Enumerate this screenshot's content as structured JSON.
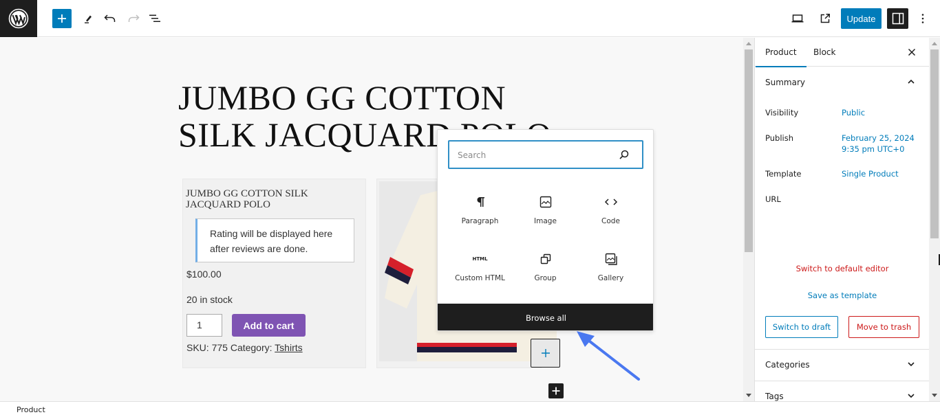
{
  "toolbar": {
    "logo": "wordpress-logo",
    "inserter_icon": "plus-icon",
    "tools_icon": "pencil-icon",
    "undo_icon": "undo-icon",
    "redo_icon": "redo-icon",
    "list_view_icon": "list-view-icon",
    "preview_icon": "desktop-icon",
    "view_post_icon": "external-link-icon",
    "update_label": "Update",
    "settings_icon": "sidebar-icon",
    "options_icon": "more-vertical-icon"
  },
  "canvas": {
    "post_title": "JUMBO GG COTTON SILK JACQUARD POLO",
    "product": {
      "name": "JUMBO GG COTTON SILK JACQUARD POLO",
      "rating_notice": "Rating will be displayed here after reviews are done.",
      "price": "$100.00",
      "stock": "20 in stock",
      "quantity": "1",
      "add_to_cart_label": "Add to cart",
      "sku_label": "SKU:",
      "sku_value": "775",
      "category_label": "Category:",
      "category_value": "Tshirts"
    },
    "image_alt": "Cream knit polo shirt with red and navy stripes"
  },
  "inserter": {
    "search_placeholder": "Search",
    "search_value": "",
    "blocks": [
      {
        "label": "Paragraph",
        "icon": "paragraph-icon"
      },
      {
        "label": "Image",
        "icon": "image-icon"
      },
      {
        "label": "Code",
        "icon": "code-icon"
      },
      {
        "label": "Custom HTML",
        "icon": "html-icon"
      },
      {
        "label": "Group",
        "icon": "group-icon"
      },
      {
        "label": "Gallery",
        "icon": "gallery-icon"
      }
    ],
    "html_icon_text": "HTML",
    "browse_all_label": "Browse all"
  },
  "sidebar": {
    "tabs": [
      {
        "label": "Product",
        "active": true
      },
      {
        "label": "Block",
        "active": false
      }
    ],
    "summary": {
      "title": "Summary",
      "rows": [
        {
          "label": "Visibility",
          "value": "Public"
        },
        {
          "label": "Publish",
          "value_line1": "February 25, 2024",
          "value_line2": "9:35 pm UTC+0"
        },
        {
          "label": "Template",
          "value": "Single Product"
        },
        {
          "label": "URL",
          "value": ""
        }
      ],
      "switch_editor_label": "Switch to default editor",
      "save_template_label": "Save as template",
      "switch_draft_label": "Switch to draft",
      "move_trash_label": "Move to trash"
    },
    "sections": [
      {
        "title": "Categories"
      },
      {
        "title": "Tags"
      }
    ]
  },
  "footer": {
    "breadcrumb": "Product"
  },
  "colors": {
    "accent": "#007cba",
    "danger": "#cc1818",
    "cart_button": "#7f54b3",
    "annotation_arrow": "#4a78f0"
  }
}
